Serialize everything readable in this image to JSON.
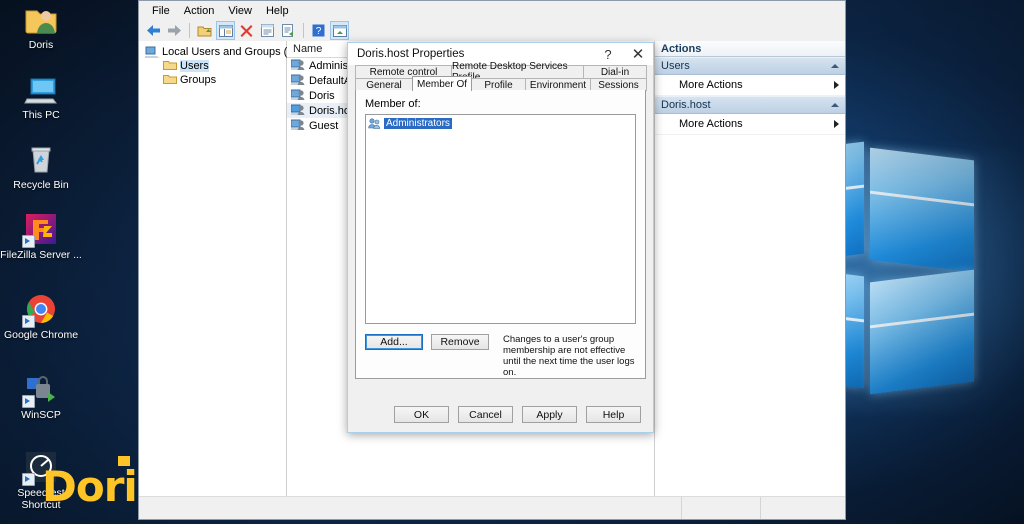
{
  "desktop": {
    "icons": [
      {
        "name": "Doris",
        "icon": "user-folder-icon"
      },
      {
        "name": "This PC",
        "icon": "computer-icon"
      },
      {
        "name": "Recycle Bin",
        "icon": "recycle-bin-icon"
      },
      {
        "name": "FileZilla Server ...",
        "icon": "filezilla-icon"
      },
      {
        "name": "Google Chrome",
        "icon": "chrome-icon"
      },
      {
        "name": "WinSCP",
        "icon": "winscp-icon"
      },
      {
        "name": "Speedtest Shortcut",
        "icon": "speedtest-icon"
      }
    ],
    "watermark": "Doris",
    "wallpaper_accent": "#1f8ee0"
  },
  "mmc": {
    "menu": [
      "File",
      "Action",
      "View",
      "Help"
    ],
    "toolbar": [
      {
        "name": "back-arrow-icon"
      },
      {
        "name": "forward-arrow-icon"
      },
      {
        "name": "separator"
      },
      {
        "name": "up-folder-icon"
      },
      {
        "name": "show-hide-tree-icon"
      },
      {
        "name": "delete-icon"
      },
      {
        "name": "properties-icon"
      },
      {
        "name": "export-list-icon"
      },
      {
        "name": "separator"
      },
      {
        "name": "help-icon"
      },
      {
        "name": "refresh-icon"
      }
    ],
    "tree": {
      "root": "Local Users and Groups (Local)",
      "children": [
        {
          "label": "Users",
          "selected": true
        },
        {
          "label": "Groups",
          "selected": false
        }
      ]
    },
    "list": {
      "header": "Name",
      "rows": [
        {
          "label": "Administrator",
          "selected": false
        },
        {
          "label": "DefaultAccount",
          "selected": false
        },
        {
          "label": "Doris",
          "selected": false
        },
        {
          "label": "Doris.host",
          "selected": true
        },
        {
          "label": "Guest",
          "selected": false
        }
      ]
    },
    "actions": {
      "title": "Actions",
      "groups": [
        {
          "title": "Users",
          "items": [
            "More Actions"
          ]
        },
        {
          "title": "Doris.host",
          "items": [
            "More Actions"
          ]
        }
      ]
    }
  },
  "dialog": {
    "title": "Doris.host Properties",
    "help_caption": "?",
    "close_caption": "✕",
    "tabs_row1": [
      {
        "label": "Remote control",
        "selected": false
      },
      {
        "label": "Remote Desktop Services Profile",
        "selected": false
      },
      {
        "label": "Dial-in",
        "selected": false
      }
    ],
    "tabs_row2": [
      {
        "label": "General",
        "selected": false
      },
      {
        "label": "Member Of",
        "selected": true
      },
      {
        "label": "Profile",
        "selected": false
      },
      {
        "label": "Environment",
        "selected": false
      },
      {
        "label": "Sessions",
        "selected": false
      }
    ],
    "member_label": "Member of:",
    "members": [
      {
        "label": "Administrators",
        "selected": true
      }
    ],
    "add_label": "Add...",
    "remove_label": "Remove",
    "hint": "Changes to a user's group membership are not effective until the next time the user logs on.",
    "footer_buttons": [
      "OK",
      "Cancel",
      "Apply",
      "Help"
    ],
    "selection_color": "#2a6bc4"
  }
}
